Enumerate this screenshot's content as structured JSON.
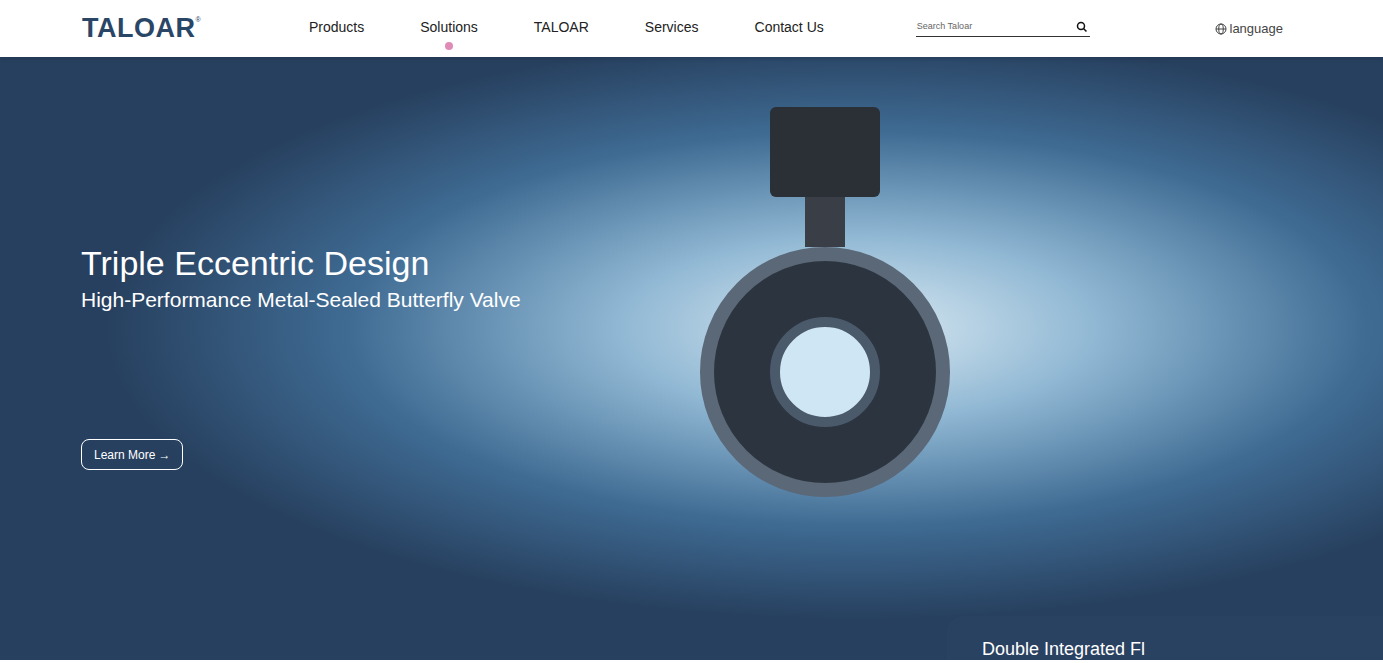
{
  "header": {
    "logo": {
      "text": "TALOAR",
      "mark": "®"
    },
    "nav": [
      {
        "label": "Products",
        "selected": false
      },
      {
        "label": "Solutions",
        "selected": true
      },
      {
        "label": "TALOAR",
        "selected": false
      },
      {
        "label": "Services",
        "selected": false
      },
      {
        "label": "Contact Us",
        "selected": false
      }
    ],
    "search": {
      "placeholder": "Search Taloar"
    },
    "language": "language"
  },
  "hero": {
    "title": "Triple Eccentric Design",
    "subtitle": "High-Performance Metal-Sealed Butterfly Valve",
    "button": {
      "label": "Learn More",
      "arrow": "→"
    }
  },
  "card": {
    "text": "Double Integrated Fl"
  }
}
